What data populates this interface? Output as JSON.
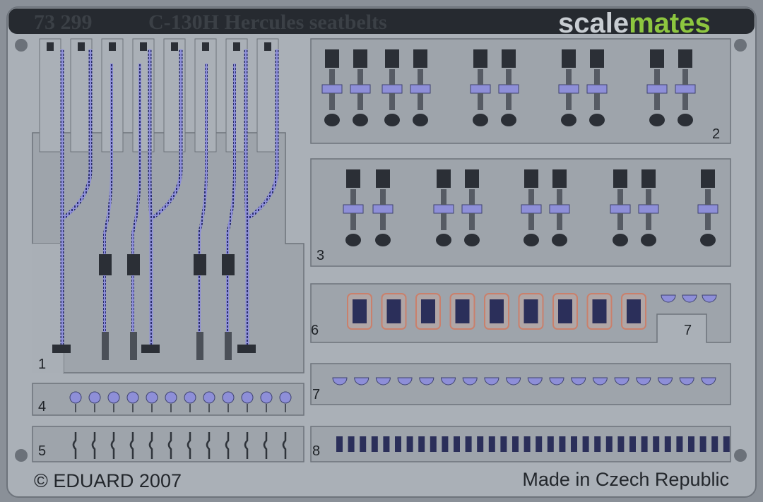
{
  "header": {
    "code": "73 299",
    "title": "C-130H Hercules seatbelts"
  },
  "watermark": {
    "part1": "scale",
    "part2": "mates",
    "color1": "#c8cdd2",
    "color2": "#8dc63f"
  },
  "footer": {
    "copyright": "© EDUARD 2007",
    "origin": "Made in Czech Republic"
  },
  "fret_numbers": {
    "n1": "1",
    "n2": "2",
    "n3": "3",
    "n4": "4",
    "n5": "5",
    "n6": "6",
    "n7a": "7",
    "n7b": "7",
    "n8": "8"
  },
  "colors": {
    "fret_base": "#a9afb6",
    "part_bg": "#9ea4ab",
    "strap_color": "#8e8fd8",
    "dark_metal": "#2b2f36",
    "buckle_frame": "#c9806c"
  }
}
